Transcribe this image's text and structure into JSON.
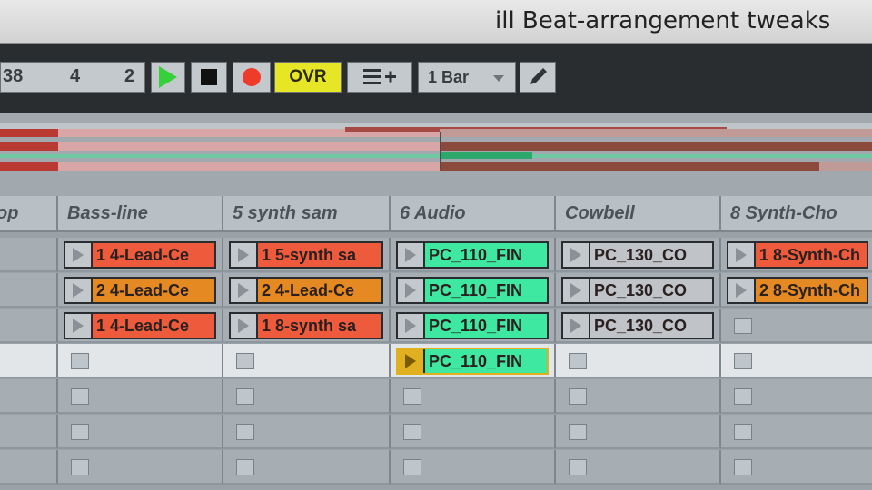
{
  "title": "ill Beat-arrangement tweaks",
  "transport": {
    "position": [
      "38",
      "4",
      "2"
    ],
    "ovr_label": "OVR",
    "quantization": "1 Bar"
  },
  "icons": {
    "play": "play-icon",
    "stop": "stop-icon",
    "record": "record-icon",
    "menu": "menu-add-icon",
    "pencil": "pencil-icon",
    "dropdown": "chevron-down-icon"
  },
  "colors": {
    "play": "#35d03a",
    "record": "#ee3b2a",
    "ovr": "#e7e626",
    "clip_red": "#ee5a3c",
    "clip_orange": "#e58a22",
    "clip_green": "#3fe8a0",
    "clip_gray": "#c0c4c8",
    "playing": "#e0b020"
  },
  "tracks": [
    {
      "name": "op"
    },
    {
      "name": "Bass-line"
    },
    {
      "name": "5 synth sam"
    },
    {
      "name": "6 Audio"
    },
    {
      "name": "Cowbell"
    },
    {
      "name": "8 Synth-Cho"
    }
  ],
  "clips": [
    [
      null,
      {
        "name": "1 4-Lead-Ce",
        "color": "#ee5a3c"
      },
      {
        "name": "1 5-synth sa",
        "color": "#ee5a3c"
      },
      {
        "name": "PC_110_FIN",
        "color": "#3fe8a0"
      },
      {
        "name": "PC_130_CO",
        "color": "#c0c4c8"
      },
      {
        "name": "1 8-Synth-Ch",
        "color": "#ee5a3c"
      }
    ],
    [
      null,
      {
        "name": "2 4-Lead-Ce",
        "color": "#e58a22"
      },
      {
        "name": "2 4-Lead-Ce",
        "color": "#e58a22"
      },
      {
        "name": "PC_110_FIN",
        "color": "#3fe8a0"
      },
      {
        "name": "PC_130_CO",
        "color": "#c0c4c8"
      },
      {
        "name": "2 8-Synth-Ch",
        "color": "#e58a22"
      }
    ],
    [
      null,
      {
        "name": "1 4-Lead-Ce",
        "color": "#ee5a3c"
      },
      {
        "name": "1 8-synth sa",
        "color": "#ee5a3c"
      },
      {
        "name": "PC_110_FIN",
        "color": "#3fe8a0"
      },
      {
        "name": "PC_130_CO",
        "color": "#c0c4c8"
      },
      null
    ],
    [
      null,
      null,
      null,
      {
        "name": "PC_110_FIN",
        "color": "#3fe8a0",
        "playing": true
      },
      null,
      null
    ],
    [
      null,
      null,
      null,
      null,
      null,
      null
    ],
    [
      null,
      null,
      null,
      null,
      null,
      null
    ],
    [
      null,
      null,
      null,
      null,
      null,
      null
    ]
  ],
  "selected_scene": 3
}
